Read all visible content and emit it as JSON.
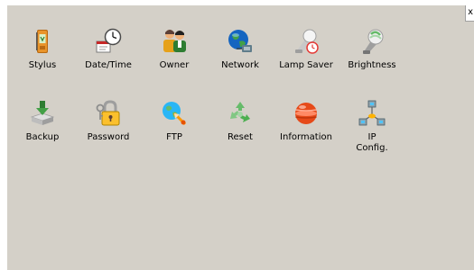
{
  "window": {
    "close_label": "x"
  },
  "applets": [
    {
      "label": "Stylus",
      "icon": "stylus-icon"
    },
    {
      "label": "Date/Time",
      "icon": "date-time-icon"
    },
    {
      "label": "Owner",
      "icon": "owner-icon"
    },
    {
      "label": "Network",
      "icon": "network-icon"
    },
    {
      "label": "Lamp Saver",
      "icon": "lamp-saver-icon"
    },
    {
      "label": "Brightness",
      "icon": "brightness-icon"
    },
    {
      "label": "Backup",
      "icon": "backup-icon"
    },
    {
      "label": "Password",
      "icon": "password-icon"
    },
    {
      "label": "FTP",
      "icon": "ftp-icon"
    },
    {
      "label": "Reset",
      "icon": "reset-icon"
    },
    {
      "label": "Information",
      "icon": "information-icon"
    },
    {
      "label": "IP\nConfig.",
      "icon": "ip-config-icon"
    }
  ],
  "colors": {
    "panel_background": "#d4d0c8",
    "page_background": "#ffffff",
    "text": "#000000"
  }
}
